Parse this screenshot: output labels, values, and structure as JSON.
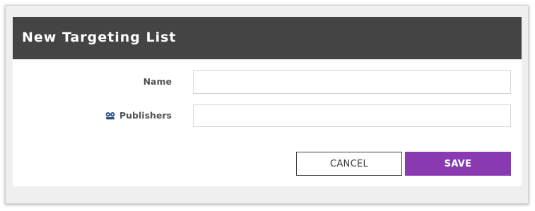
{
  "dialog": {
    "title": "New Targeting List"
  },
  "form": {
    "name_label": "Name",
    "name_value": "",
    "publishers_label": "Publishers",
    "publishers_icon": "publishers-icon",
    "publishers_value": ""
  },
  "actions": {
    "cancel_label": "CANCEL",
    "save_label": "SAVE"
  },
  "colors": {
    "header_bg": "#444444",
    "save_bg": "#8a3ab1",
    "icon_color": "#2f4f8f"
  }
}
